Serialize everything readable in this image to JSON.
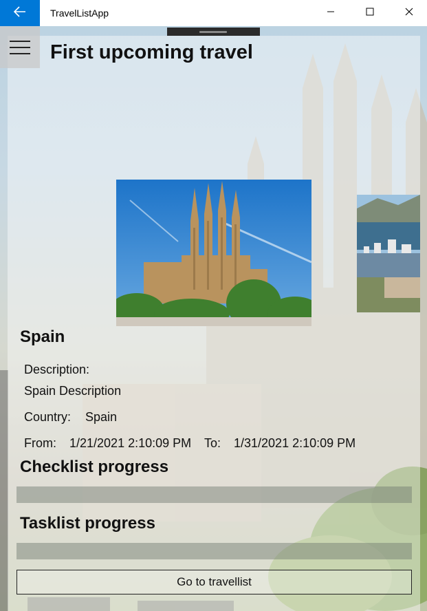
{
  "window": {
    "app_title": "TravelListApp"
  },
  "page": {
    "title": "First upcoming travel"
  },
  "travel": {
    "name": "Spain",
    "description_label": "Description:",
    "description_value": "Spain Description",
    "country_label": "Country:",
    "country_value": "Spain",
    "from_label": "From:",
    "from_value": "1/21/2021 2:10:09 PM",
    "to_label": "To:",
    "to_value": "1/31/2021 2:10:09 PM"
  },
  "progress": {
    "checklist_title": "Checklist progress",
    "checklist_value": 0,
    "tasklist_title": "Tasklist progress",
    "tasklist_value": 0
  },
  "actions": {
    "go_label": "Go to travellist"
  },
  "colors": {
    "accent": "#0078d7"
  }
}
